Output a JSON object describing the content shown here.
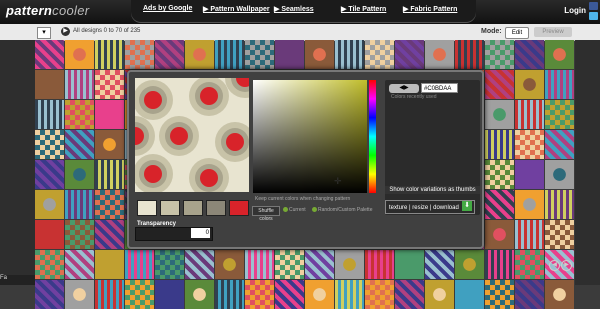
{
  "header": {
    "logo_text": "pattern",
    "logo_accent": "cooler",
    "nav": [
      "Ads by Google",
      "▶ Pattern Wallpaper",
      "▶ Seamless",
      "▶ Tile Pattern",
      "▶ Fabric Pattern"
    ],
    "login": "Login"
  },
  "subbar": {
    "dropdown": "▾",
    "play": "▶",
    "designs_text": "All designs 0 to 70 of 235",
    "mode_label": "Mode:",
    "edit": "Edit",
    "preview": "Preview"
  },
  "editor": {
    "hex_value": "#C0BDAA",
    "recent_label": "Colors recently used",
    "variations": "Show color variations as thumbs",
    "texture_links": "texture | resize | download",
    "keep_label": "Keep current colors when changing pattern",
    "shuffle": "Shuffle colors",
    "radio_current": "Current",
    "radio_random": "Random/Custom Palette",
    "transparency_label": "Transparency",
    "transparency_value": "0",
    "swatches": [
      "#e8e4d0",
      "#c8c3a8",
      "#a8a38c",
      "#8c8778",
      "#d8232a"
    ],
    "preview_colors": {
      "bg": "#e8e4d0",
      "mid": "#c8c3a8",
      "ring": "#a8a38c",
      "dot": "#d8232a"
    }
  },
  "bottom_tab": "Fa",
  "nav_prev": "◀",
  "nav_next": "▶"
}
